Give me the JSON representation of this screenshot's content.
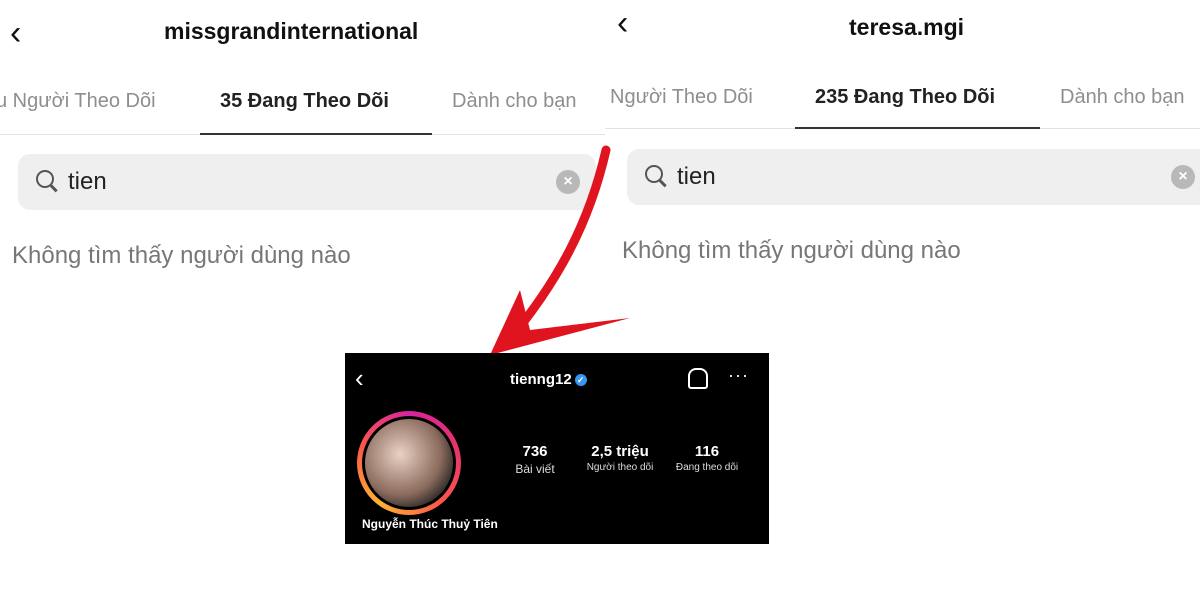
{
  "left_panel": {
    "title": "missgrandinternational",
    "tabs": [
      "u Người Theo Dõi",
      "35 Đang Theo Dõi",
      "Dành cho bạn"
    ],
    "active_tab": 1,
    "search_value": "tien",
    "empty_message": "Không tìm thấy người dùng nào"
  },
  "right_panel": {
    "title": "teresa.mgi",
    "tabs": [
      "Người Theo Dõi",
      "235 Đang Theo Dõi",
      "Dành cho bạn"
    ],
    "active_tab": 1,
    "search_value": "tien",
    "empty_message": "Không tìm thấy người dùng nào"
  },
  "profile_card": {
    "username": "tienng12",
    "verified": true,
    "stats": [
      {
        "value": "736",
        "label": "Bài viết"
      },
      {
        "value": "2,5 triệu",
        "label": "Người theo dõi"
      },
      {
        "value": "116",
        "label": "Đang theo dõi"
      }
    ],
    "full_name": "Nguyễn Thúc Thuỷ Tiên",
    "more_glyph": "···"
  },
  "colors": {
    "arrow": "#e0141e",
    "verified": "#3897f0",
    "card_bg": "#000000"
  }
}
